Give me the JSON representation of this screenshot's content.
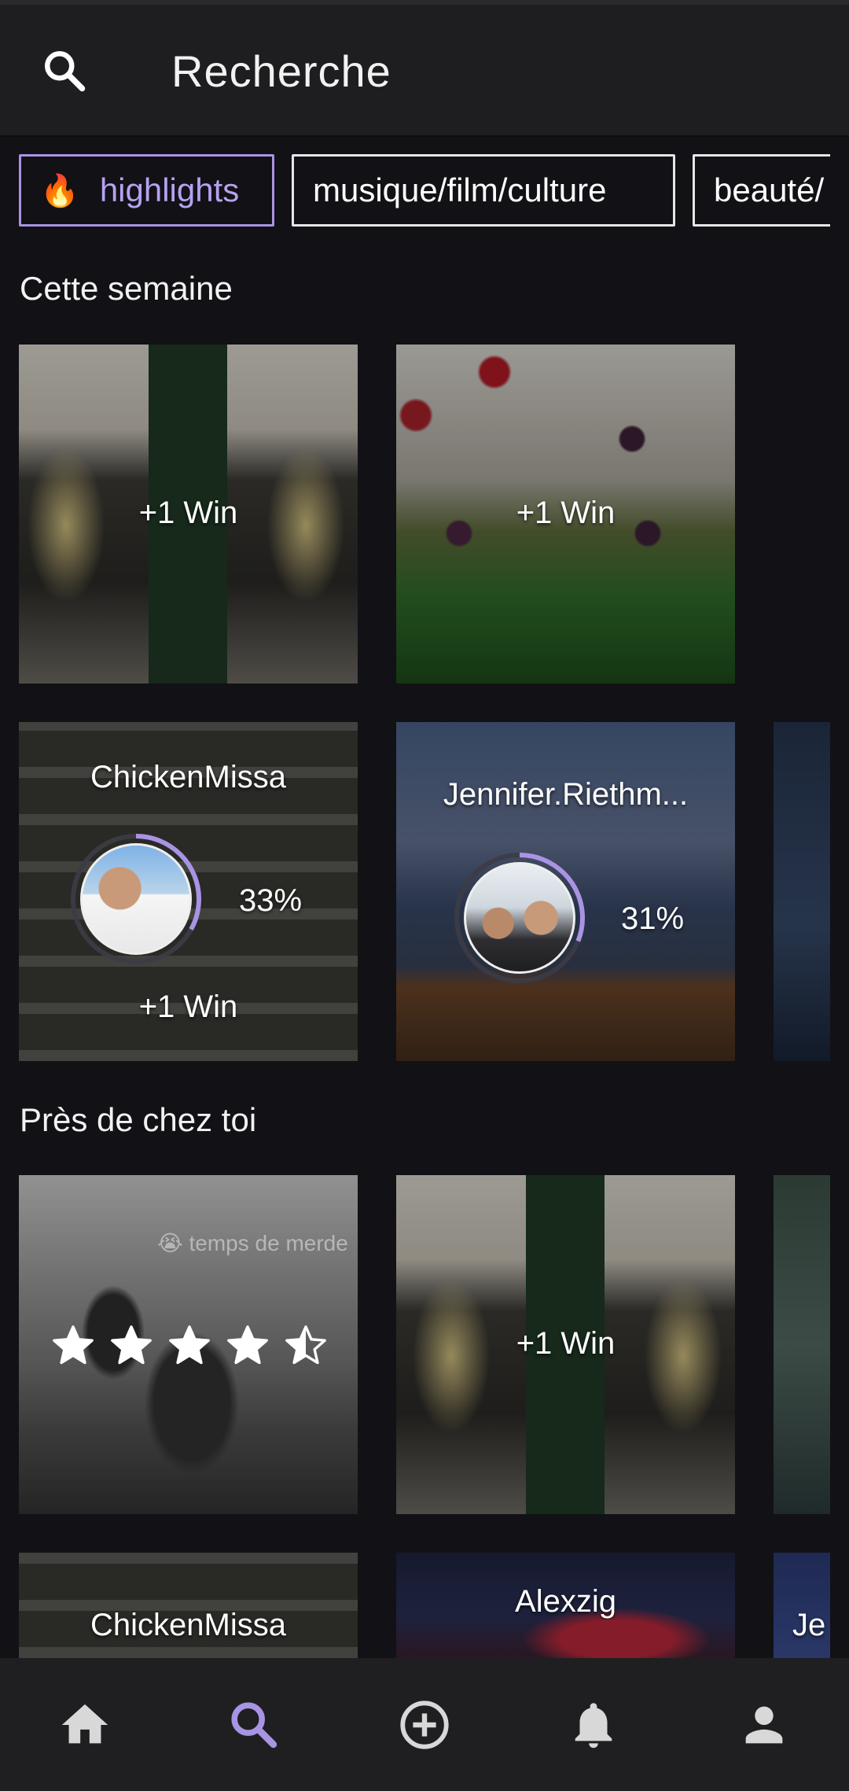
{
  "header": {
    "title": "Recherche",
    "icon": "search-icon"
  },
  "categories": [
    {
      "label": "highlights",
      "icon": "flame-icon",
      "active": true
    },
    {
      "label": "musique/film/culture",
      "active": false
    },
    {
      "label": "beauté/",
      "active": false
    }
  ],
  "sections": [
    {
      "title": "Cette semaine"
    },
    {
      "title": "Près de chez toi"
    }
  ],
  "week_row1": [
    {
      "label": "+1 Win",
      "scene": "champagne"
    },
    {
      "label": "+1 Win",
      "scene": "tulips"
    }
  ],
  "week_row2": [
    {
      "user": "ChickenMissa",
      "percent": "33%",
      "label": "+1 Win",
      "progress": 0.33
    },
    {
      "user": "Jennifer.Riethm...",
      "percent": "31%",
      "label": "",
      "progress": 0.31
    }
  ],
  "near_row1": [
    {
      "caption": "😭 temps de merde",
      "rating": 4.5,
      "rating_max": 5
    },
    {
      "label": "+1 Win",
      "scene": "champagne"
    }
  ],
  "near_row2": [
    {
      "user": "ChickenMissa"
    },
    {
      "user": "Alexzig"
    },
    {
      "user": "Je"
    }
  ],
  "colors": {
    "accent": "#a993e3",
    "background": "#121116",
    "nav": "#1f1f22"
  },
  "bottom_nav": [
    {
      "name": "home-icon",
      "active": false
    },
    {
      "name": "search-icon",
      "active": true
    },
    {
      "name": "add-circle-icon",
      "active": false
    },
    {
      "name": "bell-icon",
      "active": false
    },
    {
      "name": "profile-icon",
      "active": false
    }
  ]
}
